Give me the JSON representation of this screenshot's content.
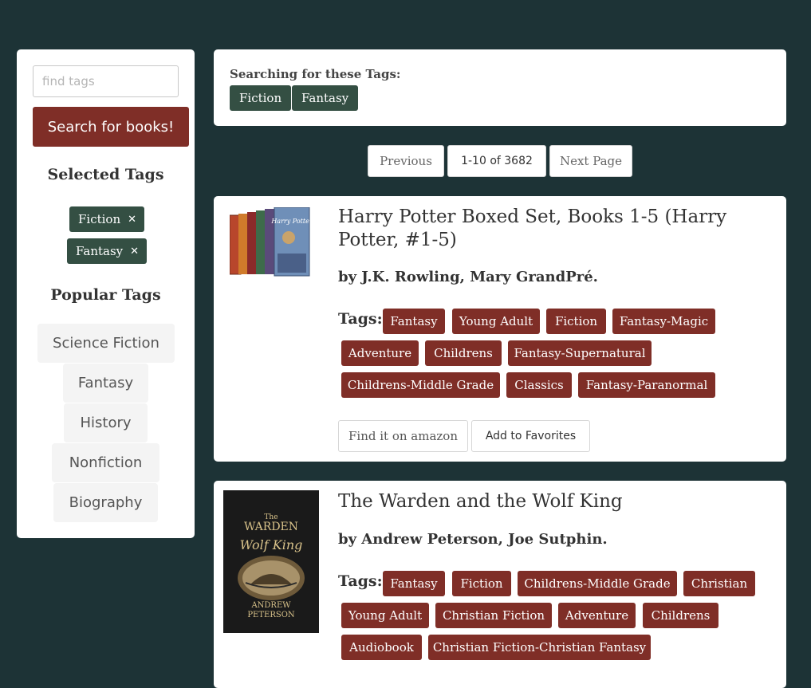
{
  "sidebar": {
    "search_placeholder": "find tags",
    "search_button": "Search for books!",
    "selected_heading": "Selected Tags",
    "selected_tags": [
      "Fiction",
      "Fantasy"
    ],
    "remove_glyph": "✕",
    "popular_heading": "Popular Tags",
    "popular_tags": [
      "Science Fiction",
      "Fantasy",
      "History",
      "Nonfiction",
      "Biography"
    ]
  },
  "search_panel": {
    "label": "Searching for these Tags:",
    "tags": [
      "Fiction",
      "Fantasy"
    ]
  },
  "pagination": {
    "previous": "Previous",
    "range": "1-10 of 3682",
    "next": "Next Page"
  },
  "books": [
    {
      "title": "Harry Potter Boxed Set, Books 1-5 (Harry Potter, #1-5)",
      "author": "by J.K. Rowling, Mary GrandPré.",
      "tags_label": "Tags:",
      "tags": [
        "Fantasy",
        "Young Adult",
        "Fiction",
        "Fantasy-Magic",
        "Adventure",
        "Childrens",
        "Fantasy-Supernatural",
        "Childrens-Middle Grade",
        "Classics",
        "Fantasy-Paranormal"
      ],
      "amazon_button": "Find it on amazon",
      "favorite_button": "Add to Favorites",
      "cover_text": "Harry Potter"
    },
    {
      "title": "The Warden and the Wolf King",
      "author": "by Andrew Peterson, Joe Sutphin.",
      "tags_label": "Tags:",
      "tags": [
        "Fantasy",
        "Fiction",
        "Childrens-Middle Grade",
        "Christian",
        "Young Adult",
        "Christian Fiction",
        "Adventure",
        "Childrens",
        "Audiobook",
        "Christian Fiction-Christian Fantasy"
      ],
      "cover_title_1": "The",
      "cover_title_2": "WARDEN",
      "cover_title_3": "Wolf King",
      "cover_author_1": "ANDREW",
      "cover_author_2": "PETERSON"
    }
  ],
  "colors": {
    "background": "#1d3336",
    "tag_red": "#7f2e27",
    "chip_green": "#344f43",
    "panel": "#ffffff"
  }
}
